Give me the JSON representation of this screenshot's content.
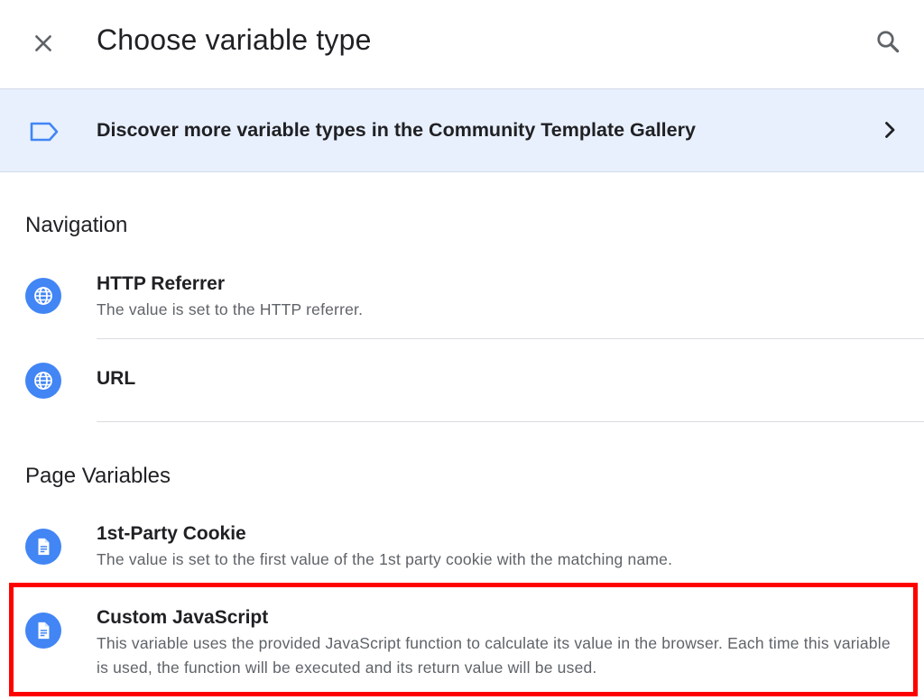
{
  "header": {
    "title": "Choose variable type",
    "close_icon": "close-icon",
    "search_icon": "search-icon"
  },
  "banner": {
    "text": "Discover more variable types in the Community Template Gallery",
    "icon": "tag-icon",
    "chevron_icon": "chevron-right-icon"
  },
  "sections": [
    {
      "heading": "Navigation",
      "items": [
        {
          "title": "HTTP Referrer",
          "description": "The value is set to the HTTP referrer.",
          "icon": "globe-icon"
        },
        {
          "title": "URL",
          "description": "",
          "icon": "globe-icon"
        }
      ]
    },
    {
      "heading": "Page Variables",
      "items": [
        {
          "title": "1st-Party Cookie",
          "description": "The value is set to the first value of the 1st party cookie with the matching name.",
          "icon": "document-icon"
        },
        {
          "title": "Custom JavaScript",
          "description": "This variable uses the provided JavaScript function to calculate its value in the browser. Each time this variable is used, the function will be executed and its return value will be used.",
          "icon": "document-icon",
          "highlighted": true
        }
      ]
    }
  ],
  "colors": {
    "accent_blue": "#4285f4",
    "banner_bg": "#e8f0fe",
    "highlight_red": "#ff0000",
    "secondary_text": "#5f6368"
  }
}
